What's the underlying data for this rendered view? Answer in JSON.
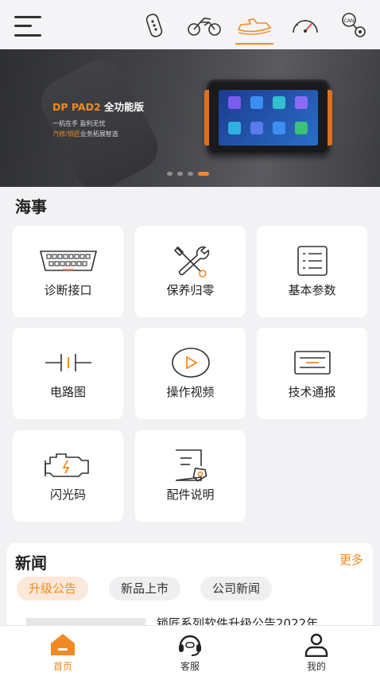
{
  "colors": {
    "accent": "#f08a24",
    "background": "#f2f2f4"
  },
  "header": {
    "menu_icon": "hamburger-menu-icon",
    "vehicle_tabs": [
      {
        "icon": "car-key-icon",
        "active": false
      },
      {
        "icon": "motorcycle-icon",
        "active": false
      },
      {
        "icon": "jet-ski-icon",
        "active": true
      },
      {
        "icon": "speedometer-icon",
        "active": false
      },
      {
        "icon": "can-bus-icon",
        "active": false
      }
    ]
  },
  "banner": {
    "title_accent": "DP PAD2",
    "title_rest": " 全功能版",
    "line1": "一机在手 盈利无忧",
    "line2_accent": "汽修/锁匠",
    "line2_rest": "业务拓展智选",
    "slide_count": 4,
    "active_slide": 4
  },
  "section": {
    "title": "海事"
  },
  "features": [
    {
      "label": "诊断接口",
      "icon": "obd-connector-icon"
    },
    {
      "label": "保养归零",
      "icon": "wrench-screwdriver-icon"
    },
    {
      "label": "基本参数",
      "icon": "parameter-list-icon"
    },
    {
      "label": "电路图",
      "icon": "circuit-diagram-icon"
    },
    {
      "label": "操作视频",
      "icon": "play-video-icon"
    },
    {
      "label": "技术通报",
      "icon": "bulletin-icon"
    },
    {
      "label": "闪光码",
      "icon": "engine-flash-icon"
    },
    {
      "label": "配件说明",
      "icon": "parts-document-icon"
    }
  ],
  "news": {
    "title": "新闻",
    "more": "更多",
    "tabs": [
      {
        "label": "升级公告",
        "active": true
      },
      {
        "label": "新品上市",
        "active": false
      },
      {
        "label": "公司新闻",
        "active": false
      }
    ],
    "first_item": "锁匠系列软件升级公告2022年"
  },
  "bottom_nav": [
    {
      "label": "首页",
      "icon": "home-icon",
      "active": true
    },
    {
      "label": "客服",
      "icon": "headset-icon",
      "active": false
    },
    {
      "label": "我的",
      "icon": "user-icon",
      "active": false
    }
  ]
}
